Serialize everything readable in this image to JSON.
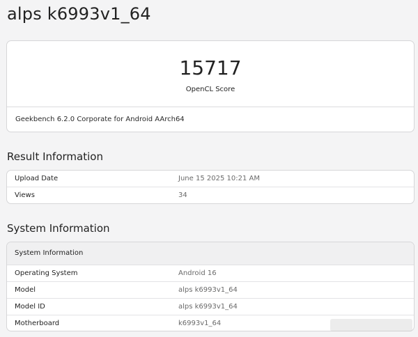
{
  "page": {
    "title": "alps k6993v1_64"
  },
  "score": {
    "value": "15717",
    "label": "OpenCL Score",
    "footer": "Geekbench 6.2.0 Corporate for Android AArch64"
  },
  "result_information": {
    "heading": "Result Information",
    "rows": [
      {
        "key": "Upload Date",
        "value": "June 15 2025 10:21 AM"
      },
      {
        "key": "Views",
        "value": "34"
      }
    ]
  },
  "system_information": {
    "heading": "System Information",
    "table_header": "System Information",
    "rows": [
      {
        "key": "Operating System",
        "value": "Android 16"
      },
      {
        "key": "Model",
        "value": "alps k6993v1_64"
      },
      {
        "key": "Model ID",
        "value": "alps k6993v1_64"
      },
      {
        "key": "Motherboard",
        "value": "k6993v1_64"
      }
    ]
  },
  "colors": {
    "background": "#f4f4f5",
    "card": "#ffffff",
    "border": "#d6d6d8",
    "value_text": "#6a6a6a"
  }
}
